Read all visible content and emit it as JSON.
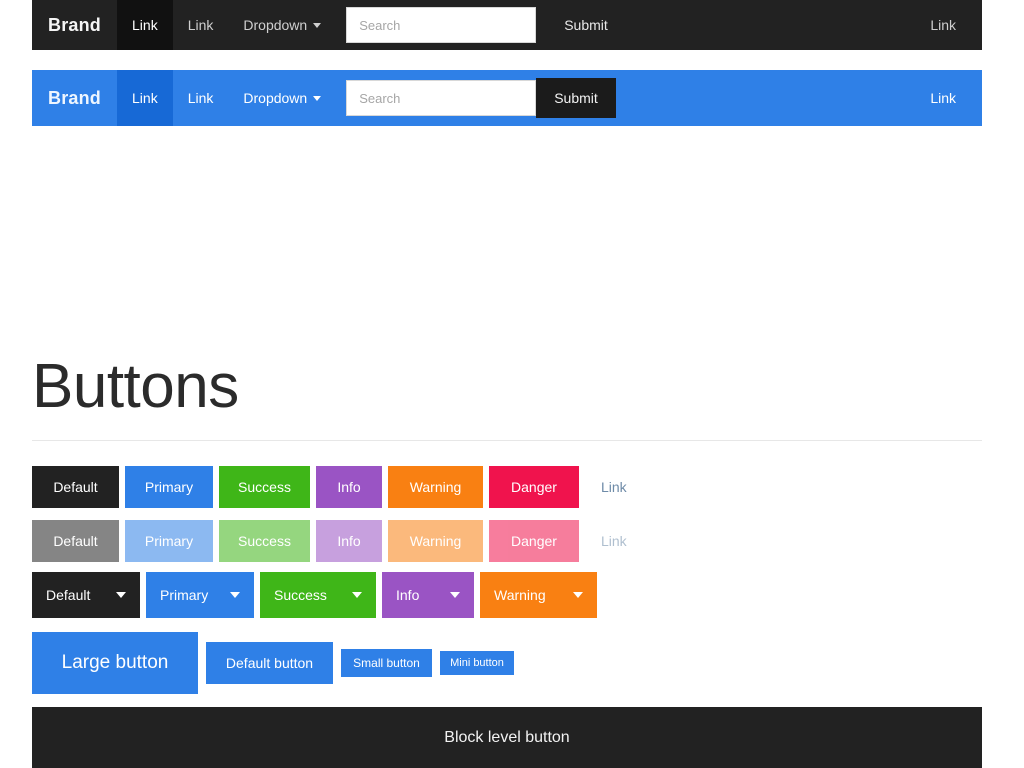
{
  "navbars": [
    {
      "theme": "dark",
      "brand": "Brand",
      "links": [
        {
          "label": "Link",
          "active": true
        },
        {
          "label": "Link",
          "active": false
        }
      ],
      "dropdown": {
        "label": "Dropdown",
        "caret": "caret-down-icon"
      },
      "search": {
        "placeholder": "Search",
        "value": ""
      },
      "submit": "Submit",
      "right_link": "Link"
    },
    {
      "theme": "blue",
      "brand": "Brand",
      "links": [
        {
          "label": "Link",
          "active": true
        },
        {
          "label": "Link",
          "active": false
        }
      ],
      "dropdown": {
        "label": "Dropdown",
        "caret": "caret-down-icon"
      },
      "search": {
        "placeholder": "Search",
        "value": ""
      },
      "submit": "Submit",
      "right_link": "Link"
    }
  ],
  "section": {
    "title": "Buttons"
  },
  "button_rows": {
    "standard": [
      {
        "label": "Default",
        "variant": "default"
      },
      {
        "label": "Primary",
        "variant": "primary"
      },
      {
        "label": "Success",
        "variant": "success"
      },
      {
        "label": "Info",
        "variant": "info"
      },
      {
        "label": "Warning",
        "variant": "warning"
      },
      {
        "label": "Danger",
        "variant": "danger"
      },
      {
        "label": "Link",
        "variant": "link"
      }
    ],
    "disabled": [
      {
        "label": "Default",
        "variant": "default"
      },
      {
        "label": "Primary",
        "variant": "primary"
      },
      {
        "label": "Success",
        "variant": "success"
      },
      {
        "label": "Info",
        "variant": "info"
      },
      {
        "label": "Warning",
        "variant": "warning"
      },
      {
        "label": "Danger",
        "variant": "danger"
      },
      {
        "label": "Link",
        "variant": "link"
      }
    ],
    "dropdowns": [
      {
        "label": "Default",
        "variant": "default"
      },
      {
        "label": "Primary",
        "variant": "primary"
      },
      {
        "label": "Success",
        "variant": "success"
      },
      {
        "label": "Info",
        "variant": "info"
      },
      {
        "label": "Warning",
        "variant": "warning"
      }
    ],
    "sizes": [
      {
        "label": "Large button",
        "size": "large"
      },
      {
        "label": "Default button",
        "size": "default"
      },
      {
        "label": "Small button",
        "size": "small"
      },
      {
        "label": "Mini button",
        "size": "mini"
      }
    ],
    "block": {
      "label": "Block level button"
    }
  },
  "colors": {
    "dark": "#222222",
    "primary": "#2f80e7",
    "primary_active": "#1769d6",
    "success": "#3fb618",
    "info": "#9a54c4",
    "warning": "#f98012",
    "danger": "#f0134d",
    "link_text": "#6e8ba8",
    "divider": "#e7e7e7",
    "page_bg": "#ffffff"
  }
}
